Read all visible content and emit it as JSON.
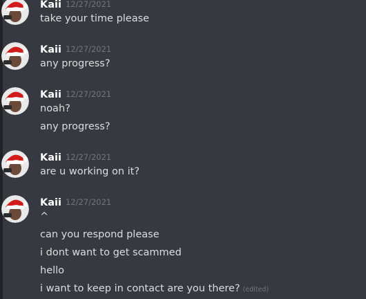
{
  "messages": [
    {
      "author": "Kaii",
      "timestamp": "12/27/2021",
      "lines": [
        "take your time please"
      ]
    },
    {
      "author": "Kaii",
      "timestamp": "12/27/2021",
      "lines": [
        "any progress?"
      ]
    },
    {
      "author": "Kaii",
      "timestamp": "12/27/2021",
      "lines": [
        "noah?",
        "any progress?"
      ]
    },
    {
      "author": "Kaii",
      "timestamp": "12/27/2021",
      "lines": [
        "are u working on it?"
      ]
    },
    {
      "author": "Kaii",
      "timestamp": "12/27/2021",
      "lines": [
        "^",
        "can you respond please",
        "i dont want to get scammed",
        "hello",
        "i want to keep in contact are you there?"
      ],
      "edited_label": "(edited)"
    }
  ],
  "colors": {
    "background": "#36393f",
    "text": "#dcddde",
    "author": "#ffffff",
    "muted": "#72767d"
  },
  "avatar_icon": "santa-hat-avatar-icon"
}
